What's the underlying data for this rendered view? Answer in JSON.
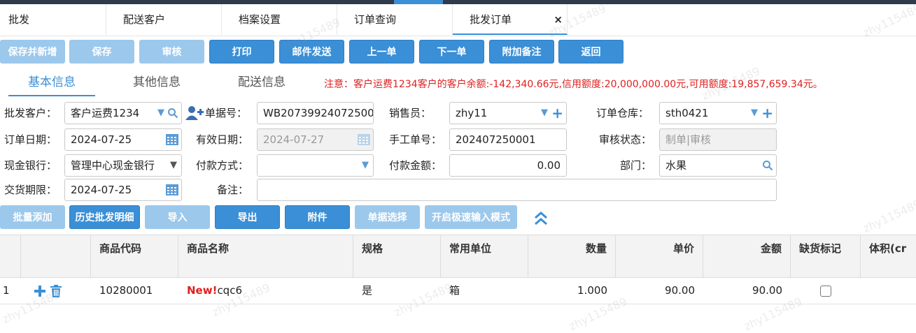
{
  "tabs": [
    {
      "label": "批发"
    },
    {
      "label": "配送客户"
    },
    {
      "label": "档案设置"
    },
    {
      "label": "订单查询"
    },
    {
      "label": "批发订单",
      "active": true,
      "close": "×"
    }
  ],
  "toolbar": {
    "save_new": "保存并新增",
    "save": "保存",
    "audit": "审核",
    "print": "打印",
    "email": "邮件发送",
    "prev": "上一单",
    "next": "下一单",
    "note": "附加备注",
    "back": "返回"
  },
  "subtabs": [
    "基本信息",
    "其他信息",
    "配送信息"
  ],
  "notice": "注意：客户运费1234客户的客户余额:-142,340.66元,信用额度:20,000,000.00元,可用额度:19,857,659.34元。",
  "form": {
    "customer": {
      "label": "批发客户：",
      "value": "客户运费1234"
    },
    "doc_no": {
      "label": "单据号：",
      "value": "WB20739924072500"
    },
    "salesman": {
      "label": "销售员：",
      "value": "zhy11"
    },
    "warehouse": {
      "label": "订单仓库：",
      "value": "sth0421"
    },
    "order_date": {
      "label": "订单日期：",
      "value": "2024-07-25"
    },
    "valid_date": {
      "label": "有效日期：",
      "value": "2024-07-27"
    },
    "manual_no": {
      "label": "手工单号：",
      "value": "202407250001"
    },
    "audit_status": {
      "label": "审核状态：",
      "placeholder": "制单|审核"
    },
    "cash_bank": {
      "label": "现金银行：",
      "value": "管理中心现金银行"
    },
    "pay_method": {
      "label": "付款方式：",
      "value": ""
    },
    "pay_amount": {
      "label": "付款金额：",
      "value": "0.00"
    },
    "dept": {
      "label": "部门：",
      "value": "水果"
    },
    "delivery_date": {
      "label": "交货期限：",
      "value": "2024-07-25"
    },
    "remark": {
      "label": "备注：",
      "value": ""
    }
  },
  "toolbar2": {
    "batch_add": "批量添加",
    "history": "历史批发明细",
    "import": "导入",
    "export": "导出",
    "attach": "附件",
    "select_doc": "单据选择",
    "fast_mode": "开启极速输入模式"
  },
  "grid": {
    "columns": [
      "商品代码",
      "商品名称",
      "规格",
      "常用单位",
      "数量",
      "单价",
      "金额",
      "缺货标记",
      "体积(cr"
    ],
    "rows": [
      {
        "index": "1",
        "code": "10280001",
        "new_tag": "New!",
        "name": "cqc6",
        "spec": "是",
        "unit": "箱",
        "qty": "1.000",
        "price": "90.00",
        "amount": "90.00",
        "shortage": false
      }
    ]
  },
  "icons": {
    "date": "calendar-icon",
    "search": "search-icon",
    "dropdown": "chevron-down-icon",
    "add": "plus-icon",
    "delete": "trash-icon",
    "collapse": "double-chevron-up-icon"
  },
  "colors": {
    "primary": "#3a8fd6",
    "disabled": "#9cc8ec",
    "warning": "#e02020"
  },
  "watermark": "zhy115489"
}
